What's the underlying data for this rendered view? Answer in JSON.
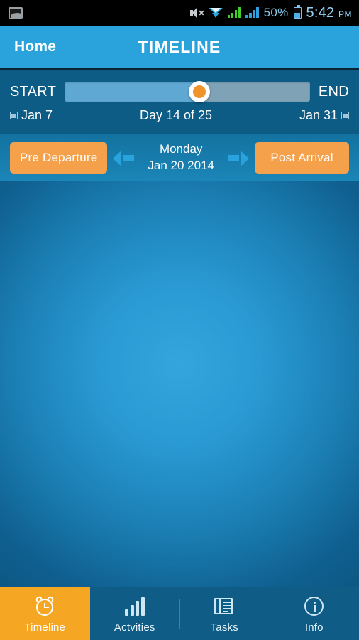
{
  "statusbar": {
    "gallery_icon": "gallery-icon",
    "mute_icon": "volume-mute-icon",
    "wifi_icon": "wifi-icon",
    "signal1_icon": "signal-bars-icon",
    "signal2_icon": "signal-bars-icon",
    "battery_percent": "50%",
    "battery_icon": "battery-icon",
    "time": "5:42",
    "ampm": "PM"
  },
  "header": {
    "back_label": "Home",
    "title": "TIMELINE"
  },
  "slider": {
    "start_label": "START",
    "end_label": "END",
    "start_date": "Jan 7",
    "end_date": "Jan 31",
    "day_count": "Day 14 of 25",
    "calendar_icon": "calendar-icon",
    "thumb_position_percent": 55,
    "track_fill_color": "#5fa8d3",
    "track_rest_color": "#7fa2b6",
    "thumb_color": "#f0932b"
  },
  "phase_row": {
    "prev_button_label": "Pre Departure",
    "next_button_label": "Post Arrival",
    "prev_arrow_icon": "arrow-left-icon",
    "next_arrow_icon": "arrow-right-icon",
    "weekday": "Monday",
    "date": "Jan 20 2014",
    "button_color": "#f5a04a",
    "arrow_color": "#29a3dd"
  },
  "bottom_nav": {
    "active_color": "#f5a623",
    "items": [
      {
        "label": "Timeline",
        "icon": "alarm-clock-icon",
        "active": true
      },
      {
        "label": "Actvities",
        "icon": "bar-chart-icon",
        "active": false
      },
      {
        "label": "Tasks",
        "icon": "documents-icon",
        "active": false
      },
      {
        "label": "Info",
        "icon": "info-circle-icon",
        "active": false
      }
    ]
  }
}
